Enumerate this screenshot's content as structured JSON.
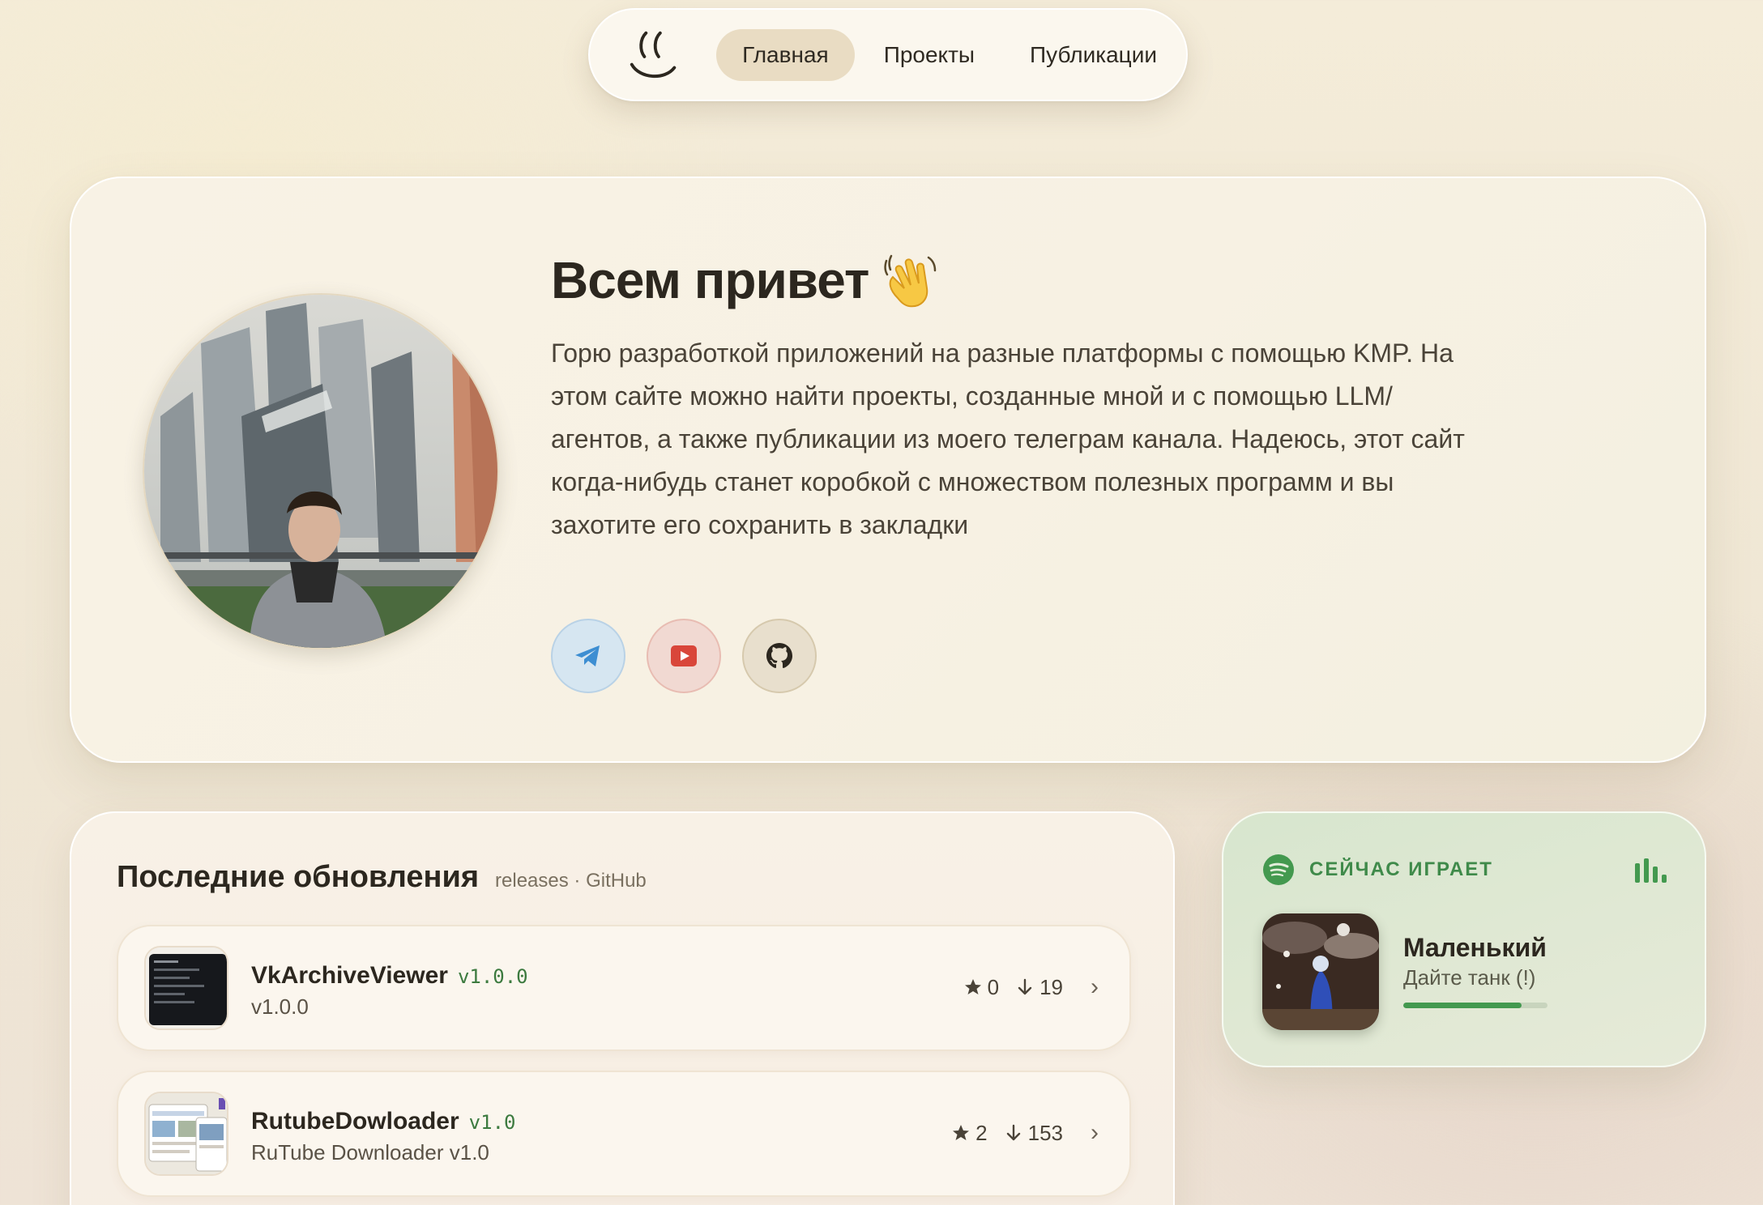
{
  "nav": {
    "logo_icon": "smile-logo-icon",
    "items": [
      {
        "label": "Главная",
        "active": true
      },
      {
        "label": "Проекты",
        "active": false
      },
      {
        "label": "Публикации",
        "active": false
      }
    ]
  },
  "hero": {
    "title": "Всем привет",
    "title_icon": "waving-hand-icon",
    "text": "Горю разработкой приложений на разные платформы с помощью KMP. На этом сайте можно найти проекты, созданные мной и с помощью LLM/агентов, а также публикации из моего телеграм канала. Надеюсь, этот сайт когда-нибудь станет коробкой с множеством полезных программ и вы захотите его сохранить в закладки",
    "socials": [
      {
        "icon": "telegram-icon",
        "color": "#3d8ed2"
      },
      {
        "icon": "youtube-icon",
        "color": "#d9463a"
      },
      {
        "icon": "github-icon",
        "color": "#2c271f"
      }
    ]
  },
  "updates": {
    "title": "Последние обновления",
    "subtitle": "releases · GitHub",
    "releases": [
      {
        "name": "VkArchiveViewer",
        "tag": "v1.0.0",
        "description": "v1.0.0",
        "stars": "0",
        "downloads": "19"
      },
      {
        "name": "RutubeDowloader",
        "tag": "v1.0",
        "description": "RuTube Downloader v1.0",
        "stars": "2",
        "downloads": "153"
      }
    ]
  },
  "now_playing": {
    "label": "СЕЙЧАС ИГРАЕТ",
    "service_icon": "spotify-icon",
    "track": "Маленький",
    "artist": "Дайте танк (!)",
    "progress_percent": 82,
    "accent": "#43994f"
  }
}
